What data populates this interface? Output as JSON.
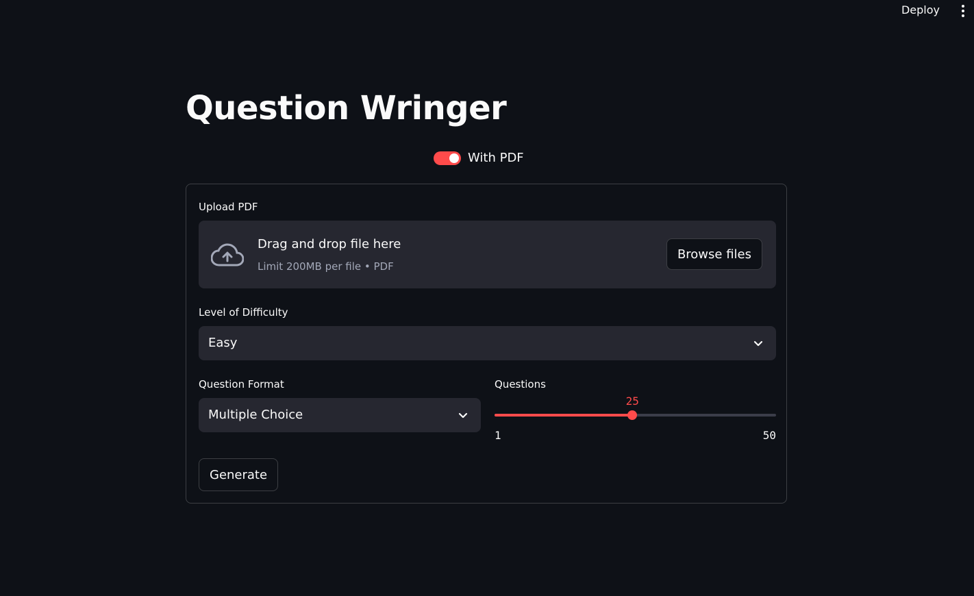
{
  "header": {
    "deploy_label": "Deploy",
    "menu_icon": "vertical-dots-icon"
  },
  "page": {
    "title": "Question Wringer"
  },
  "toggle": {
    "label": "With PDF",
    "on": true,
    "accent": "#ff4b4b"
  },
  "upload": {
    "label": "Upload PDF",
    "drop_title": "Drag and drop file here",
    "drop_sub": "Limit 200MB per file • PDF",
    "browse_label": "Browse files",
    "icon": "cloud-upload-icon"
  },
  "difficulty": {
    "label": "Level of Difficulty",
    "value": "Easy"
  },
  "format": {
    "label": "Question Format",
    "value": "Multiple Choice"
  },
  "questions": {
    "label": "Questions",
    "value": "25",
    "min": "1",
    "max": "50"
  },
  "actions": {
    "generate_label": "Generate"
  },
  "colors": {
    "background": "#0e1117",
    "surface": "#262730",
    "accent": "#ff4b4b",
    "text": "#fafafa",
    "muted": "#a3a8b8"
  }
}
